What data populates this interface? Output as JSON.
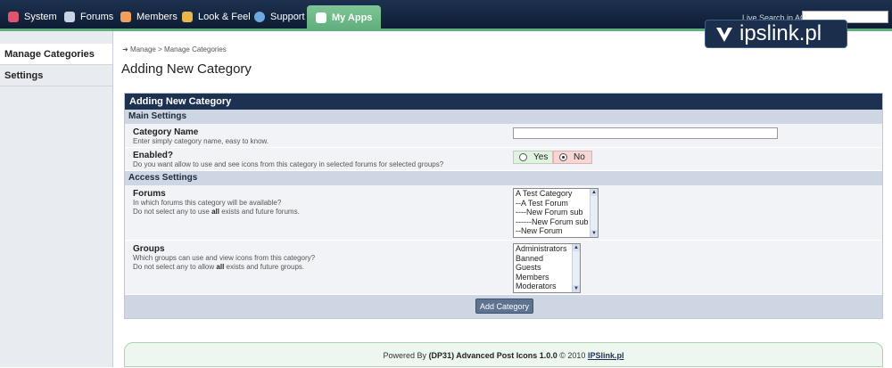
{
  "nav": {
    "tabs": [
      {
        "label": "System",
        "icon": "system-icon",
        "color": "#e0556b"
      },
      {
        "label": "Forums",
        "icon": "forums-icon",
        "color": "#c8d4e6"
      },
      {
        "label": "Members",
        "icon": "members-icon",
        "color": "#f0a05a"
      },
      {
        "label": "Look & Feel",
        "icon": "look-feel-icon",
        "color": "#e8b64a"
      },
      {
        "label": "Support",
        "icon": "support-icon",
        "color": "#6fa8e0"
      },
      {
        "label": "My Apps",
        "icon": "my-apps-icon",
        "color": "#ffffff"
      }
    ],
    "live_search_label": "Live Search in ACP:",
    "logo_text": "ipslink.pl"
  },
  "sidebar": {
    "items": [
      {
        "label": "Manage Categories"
      },
      {
        "label": "Settings"
      }
    ]
  },
  "breadcrumb": "Manage > Manage Categories",
  "page_title": "Adding New Category",
  "form": {
    "title": "Adding New Category",
    "main_settings": "Main Settings",
    "category_name": {
      "label": "Category Name",
      "desc": "Enter simply category name, easy to know.",
      "value": ""
    },
    "enabled": {
      "label": "Enabled?",
      "desc": "Do you want allow to use and see icons from this category in selected forums for selected groups?",
      "yes": "Yes",
      "no": "No",
      "selected": "No"
    },
    "access_settings": "Access Settings",
    "forums": {
      "label": "Forums",
      "desc1": "In which forums this category will be available?",
      "desc2_pre": "Do not select any to use ",
      "desc2_bold": "all",
      "desc2_post": " exists and future forums.",
      "options": [
        "A Test Category",
        "--A Test Forum",
        "----New Forum sub",
        "------New Forum sub",
        "--New Forum"
      ]
    },
    "groups": {
      "label": "Groups",
      "desc1": "Which groups can use and view icons from this category?",
      "desc2_pre": "Do not select any to allow ",
      "desc2_bold": "all",
      "desc2_post": " exists and future groups.",
      "options": [
        "Administrators",
        "Banned",
        "Guests",
        "Members",
        "Moderators"
      ]
    },
    "submit_label": "Add Category"
  },
  "footer": {
    "pre": "Powered By ",
    "bold": "(DP31) Advanced Post Icons 1.0.0",
    "mid": " © 2010 ",
    "link": "IPSlink.pl"
  }
}
